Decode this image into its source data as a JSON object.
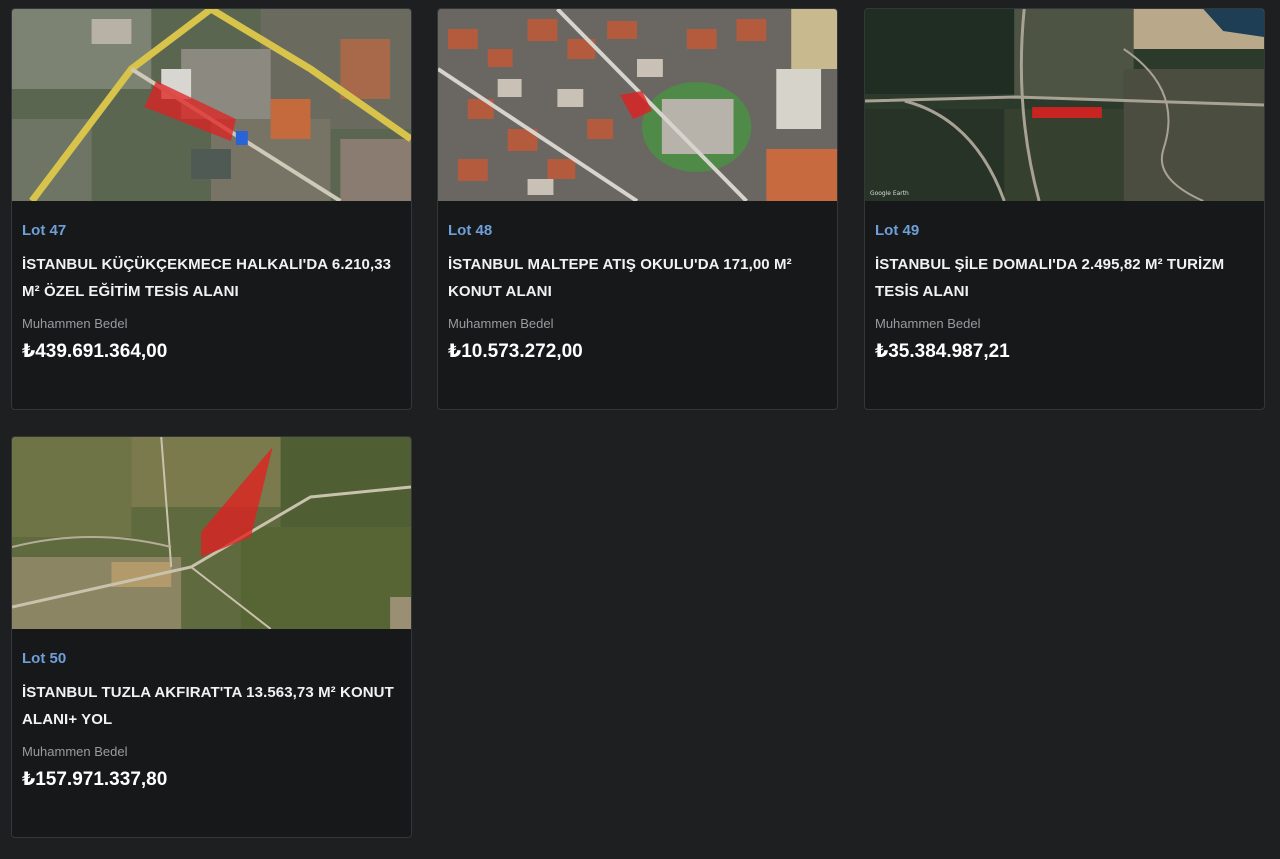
{
  "lots": [
    {
      "lot_label": "Lot 47",
      "title": "İSTANBUL KÜÇÜKÇEKMECE HALKALI'DA 6.210,33 M² ÖZEL EĞİTİM TESİS ALANI",
      "price_label": "Muhammen Bedel",
      "price": "₺439.691.364,00",
      "image": "urban-aerial-map"
    },
    {
      "lot_label": "Lot 48",
      "title": "İSTANBUL MALTEPE ATIŞ OKULU'DA 171,00 M² KONUT ALANI",
      "price_label": "Muhammen Bedel",
      "price": "₺10.573.272,00",
      "image": "dense-urban-aerial-map"
    },
    {
      "lot_label": "Lot 49",
      "title": "İSTANBUL ŞİLE DOMALI'DA 2.495,82 M² TURİZM TESİS ALANI",
      "price_label": "Muhammen Bedel",
      "price": "₺35.384.987,21",
      "image": "coastal-forest-aerial-map"
    },
    {
      "lot_label": "Lot 50",
      "title": "İSTANBUL TUZLA AKFIRAT'TA 13.563,73 M² KONUT ALANI+ YOL",
      "price_label": "Muhammen Bedel",
      "price": "₺157.971.337,80",
      "image": "rural-aerial-map"
    }
  ],
  "colors": {
    "background": "#1e1f21",
    "card": "#17181a",
    "lot_accent": "#6f9fd8",
    "parcel_highlight": "#e02020"
  }
}
